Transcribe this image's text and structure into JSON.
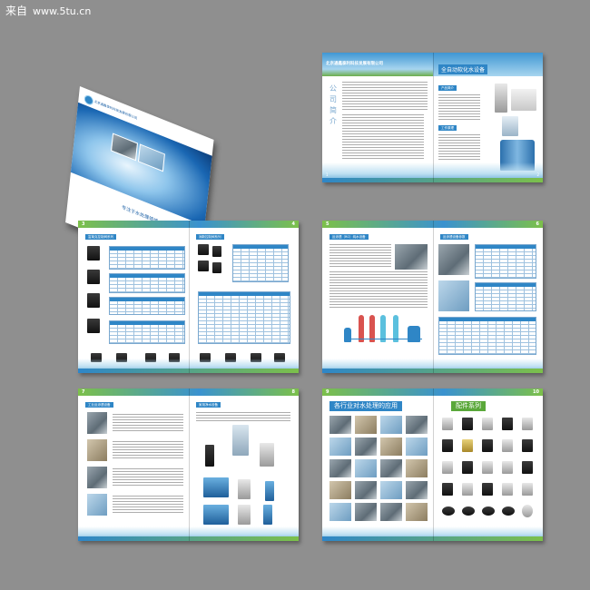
{
  "watermark": {
    "brand": "来自",
    "site": "www.5tu.cn"
  },
  "cover": {
    "company": "北京通鑫泰利科技发展有限公司",
    "title": "专注于水处理领域"
  },
  "spread1": {
    "header_left": "北京通鑫泰利科技发展有限公司",
    "header_right": "全自动软化水设备",
    "vertical_title": [
      "公",
      "司",
      "简",
      "介"
    ],
    "product_section": "产品简介",
    "work_section": "工作原理",
    "page_left": "1",
    "page_right": "2"
  },
  "spread2": {
    "page_left": "3",
    "page_right": "4",
    "sec_a": "富莱克控制阀系列",
    "sec_b": "润新控制阀系列"
  },
  "spread3": {
    "page_left": "5",
    "page_right": "6",
    "sec_a": "反渗透（RO）纯水设备",
    "sec_b": "反渗透设备参数"
  },
  "spread4": {
    "page_left": "7",
    "page_right": "8",
    "sec_a": "工业反渗透设备",
    "sec_b": "家用净水设备"
  },
  "spread5": {
    "page_left": "9",
    "page_right": "10",
    "sec_a": "各行业对水处理的应用",
    "sec_b": "配件系列"
  },
  "colors": {
    "background": "#8f8f8f",
    "brand_blue": "#2f86c6",
    "brand_green": "#5aa83a"
  }
}
